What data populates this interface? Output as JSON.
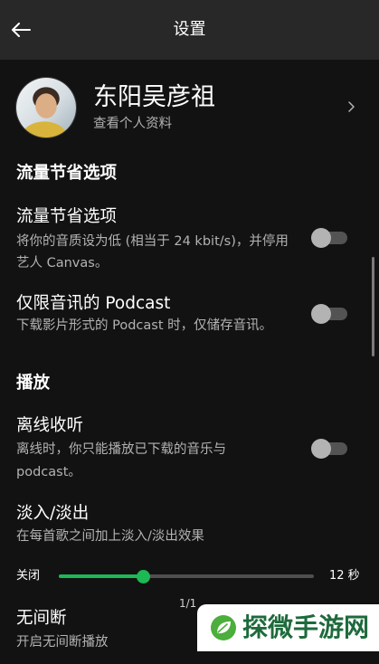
{
  "colors": {
    "background": "#121212",
    "header_background": "#282828",
    "text_primary": "#ffffff",
    "text_secondary": "#b3b3b3",
    "accent": "#1db954",
    "toggle_track_off": "#535353",
    "toggle_knob_off": "#b3b3b3"
  },
  "header": {
    "title": "设置",
    "back_icon": "arrow-left-icon"
  },
  "profile": {
    "name": "东阳吴彦祖",
    "subtitle": "查看个人资料",
    "chevron_icon": "chevron-right-icon"
  },
  "sections": [
    {
      "heading": "流量节省选项",
      "items": [
        {
          "title": "流量节省选项",
          "description": [
            "将你的音质设为低 (相当于 24 kbit/s)，并停用",
            "艺人 Canvas。"
          ],
          "toggle_on": false
        },
        {
          "title": "仅限音讯的 Podcast",
          "description": [
            "下载影片形式的 Podcast 时，仅储存音讯。"
          ],
          "toggle_on": false
        }
      ]
    },
    {
      "heading": "播放",
      "items": [
        {
          "title": "离线收听",
          "description": [
            "离线时，你只能播放已下载的音乐与",
            "podcast。"
          ],
          "toggle_on": false
        },
        {
          "title": "淡入/淡出",
          "description": [
            "在每首歌之间加上淡入/淡出效果"
          ],
          "slider": {
            "min_label": "关闭",
            "max_label": "12 秒",
            "value_fraction": 0.33
          }
        },
        {
          "title": "无间断",
          "description": [
            "开启无间断播放"
          ]
        }
      ]
    }
  ],
  "page_indicator": "1/1",
  "watermark": {
    "text": "探微手游网",
    "logo_icon": "leaf-icon"
  }
}
